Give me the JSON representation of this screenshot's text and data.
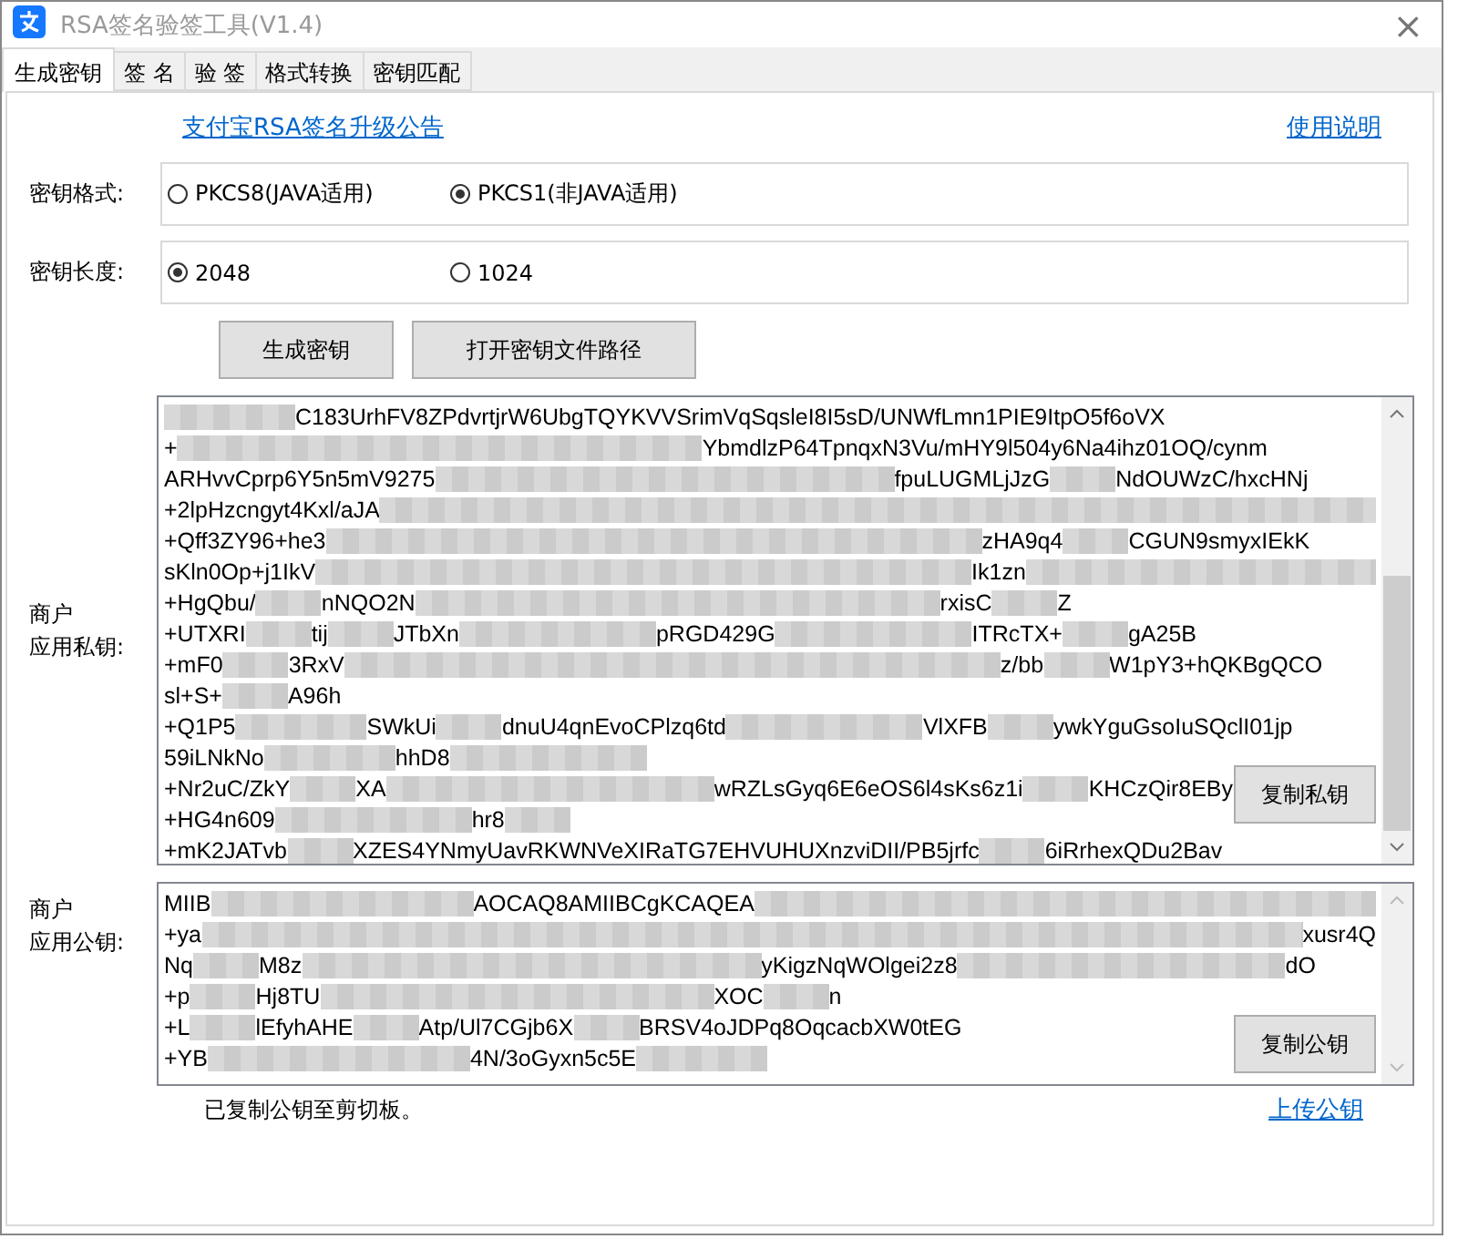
{
  "window": {
    "title": "RSA签名验签工具(V1.4)",
    "close": "×"
  },
  "tabs": [
    {
      "label": "生成密钥",
      "selected": true
    },
    {
      "label": "签 名",
      "selected": false
    },
    {
      "label": "验 签",
      "selected": false
    },
    {
      "label": "格式转换",
      "selected": false
    },
    {
      "label": "密钥匹配",
      "selected": false
    }
  ],
  "links": {
    "notice": "支付宝RSA签名升级公告",
    "help": "使用说明"
  },
  "key_format": {
    "label": "密钥格式:",
    "options": [
      {
        "label": "PKCS8(JAVA适用)",
        "selected": false
      },
      {
        "label": "PKCS1(非JAVA适用)",
        "selected": true
      }
    ]
  },
  "key_length": {
    "label": "密钥长度:",
    "options": [
      {
        "label": "2048",
        "selected": true
      },
      {
        "label": "1024",
        "selected": false
      }
    ]
  },
  "buttons": [
    "生成密钥",
    "打开密钥文件路径"
  ],
  "private_key": {
    "label": [
      "商户",
      "应用私钥:"
    ],
    "button": "复制私钥",
    "lines": [
      [
        {
          "kind": "blur"
        },
        {
          "kind": "blur"
        },
        "C183UrhFV8ZPdvrtjrW6UbgTQYKVVSrimVqSqsleI8I5sD/UNWfLmn1PIE9ItpO5f6oVX"
      ],
      [
        "+",
        {
          "kind": "blur"
        },
        {
          "kind": "blur"
        },
        {
          "kind": "blur"
        },
        {
          "kind": "blur"
        },
        {
          "kind": "blur"
        },
        {
          "kind": "blur"
        },
        {
          "kind": "blur"
        },
        {
          "kind": "blur"
        },
        "YbmdlzP64TpnqxN3Vu/mHY9l504y6Na4ihz01OQ/cynm"
      ],
      [
        "ARHvvCprp6Y5n5mV9275",
        {
          "kind": "blur"
        },
        {
          "kind": "blur"
        },
        {
          "kind": "blur"
        },
        {
          "kind": "blur"
        },
        {
          "kind": "blur"
        },
        {
          "kind": "blur"
        },
        {
          "kind": "blur"
        },
        "fpuLUGMLjJzG",
        {
          "kind": "blur"
        },
        "NdOUWzC/hxcHNj"
      ],
      [
        "+2lpHzcngyt4Kxl/aJA",
        {
          "kind": "blur_fill"
        }
      ],
      [
        "+Qff3ZY96+he3",
        {
          "kind": "blur"
        },
        {
          "kind": "blur"
        },
        {
          "kind": "blur"
        },
        {
          "kind": "blur"
        },
        {
          "kind": "blur"
        },
        {
          "kind": "blur"
        },
        {
          "kind": "blur"
        },
        {
          "kind": "blur"
        },
        {
          "kind": "blur"
        },
        {
          "kind": "blur"
        },
        "zHA9q4",
        {
          "kind": "blur"
        },
        "CGUN9smyxIEkK"
      ],
      [
        "sKln0Op+j1IkV",
        {
          "kind": "blur"
        },
        {
          "kind": "blur"
        },
        {
          "kind": "blur"
        },
        {
          "kind": "blur"
        },
        {
          "kind": "blur"
        },
        {
          "kind": "blur"
        },
        {
          "kind": "blur"
        },
        {
          "kind": "blur"
        },
        {
          "kind": "blur"
        },
        {
          "kind": "blur"
        },
        "Ik1zn",
        {
          "kind": "blur_fill"
        }
      ],
      [
        "+HgQbu/",
        {
          "kind": "blur"
        },
        "nNQO2N",
        {
          "kind": "blur"
        },
        {
          "kind": "blur"
        },
        {
          "kind": "blur"
        },
        {
          "kind": "blur"
        },
        {
          "kind": "blur"
        },
        {
          "kind": "blur"
        },
        {
          "kind": "blur"
        },
        {
          "kind": "blur"
        },
        "rxisC",
        {
          "kind": "blur"
        },
        "Z"
      ],
      [
        "+UTXRI",
        {
          "kind": "blur"
        },
        "tij",
        {
          "kind": "blur"
        },
        "JTbXn",
        {
          "kind": "blur"
        },
        {
          "kind": "blur"
        },
        {
          "kind": "blur"
        },
        "pRGD429G",
        {
          "kind": "blur"
        },
        {
          "kind": "blur"
        },
        {
          "kind": "blur"
        },
        "ITRcTX+",
        {
          "kind": "blur"
        },
        "gA25B"
      ],
      [
        "+mF0",
        {
          "kind": "blur"
        },
        "3RxV",
        {
          "kind": "blur"
        },
        {
          "kind": "blur"
        },
        {
          "kind": "blur"
        },
        {
          "kind": "blur"
        },
        {
          "kind": "blur"
        },
        {
          "kind": "blur"
        },
        {
          "kind": "blur"
        },
        {
          "kind": "blur"
        },
        {
          "kind": "blur"
        },
        {
          "kind": "blur"
        },
        "z/bb",
        {
          "kind": "blur"
        },
        "W1pY3+hQKBgQCO"
      ],
      [
        "sl+S+",
        {
          "kind": "blur"
        },
        "A96h"
      ],
      [
        "+Q1P5",
        {
          "kind": "blur"
        },
        {
          "kind": "blur"
        },
        "SWkUi",
        {
          "kind": "blur"
        },
        "dnuU4qnEvoCPlzq6td",
        {
          "kind": "blur"
        },
        {
          "kind": "blur"
        },
        {
          "kind": "blur"
        },
        "VlXFB",
        {
          "kind": "blur"
        },
        "ywkYguGsoIuSQclI01jp"
      ],
      [
        "59iLNkNo",
        {
          "kind": "blur"
        },
        {
          "kind": "blur"
        },
        "hhD8",
        {
          "kind": "blur"
        },
        {
          "kind": "blur"
        },
        {
          "kind": "blur"
        }
      ],
      [
        "+Nr2uC/ZkY",
        {
          "kind": "blur"
        },
        "XA",
        {
          "kind": "blur"
        },
        {
          "kind": "blur"
        },
        {
          "kind": "blur"
        },
        {
          "kind": "blur"
        },
        {
          "kind": "blur"
        },
        "wRZLsGyq6E6eOS6l4sKs6z1i",
        {
          "kind": "blur"
        },
        "KHCzQir8EBy"
      ],
      [
        "+HG4n609",
        {
          "kind": "blur"
        },
        {
          "kind": "blur"
        },
        {
          "kind": "blur"
        },
        "hr8",
        {
          "kind": "blur"
        }
      ],
      [
        "+mK2JATvb",
        {
          "kind": "blur"
        },
        "XZES4YNmyUavRKWNVeXIRaTG7EHVUHUXnzviDII/PB5jrfc",
        {
          "kind": "blur"
        },
        "6iRrhexQDu2Bav"
      ]
    ]
  },
  "public_key": {
    "label": [
      "商户",
      "应用公钥:"
    ],
    "button": "复制公钥",
    "lines": [
      [
        "MIIB",
        {
          "kind": "blur"
        },
        {
          "kind": "blur"
        },
        {
          "kind": "blur"
        },
        {
          "kind": "blur"
        },
        "AOCAQ8AMIIBCgKCAQEA",
        {
          "kind": "blur_fill"
        }
      ],
      [
        "+ya",
        {
          "kind": "blur_fill"
        },
        "xusr4Q"
      ],
      [
        "Nq",
        {
          "kind": "blur"
        },
        "M8z",
        {
          "kind": "blur"
        },
        {
          "kind": "blur"
        },
        {
          "kind": "blur"
        },
        {
          "kind": "blur"
        },
        {
          "kind": "blur"
        },
        {
          "kind": "blur"
        },
        {
          "kind": "blur"
        },
        "yKigzNqWOlgei2z8",
        {
          "kind": "blur"
        },
        {
          "kind": "blur"
        },
        {
          "kind": "blur"
        },
        {
          "kind": "blur"
        },
        {
          "kind": "blur"
        },
        "dO"
      ],
      [
        "+p",
        {
          "kind": "blur"
        },
        "Hj8TU",
        {
          "kind": "blur"
        },
        {
          "kind": "blur"
        },
        {
          "kind": "blur"
        },
        {
          "kind": "blur"
        },
        {
          "kind": "blur"
        },
        {
          "kind": "blur"
        },
        "XOC",
        {
          "kind": "blur"
        },
        "n"
      ],
      [
        "+L",
        {
          "kind": "blur"
        },
        "lEfyhAHE",
        {
          "kind": "blur"
        },
        "Atp/Ul7CGjb6X",
        {
          "kind": "blur"
        },
        "BRSV4oJDPq8OqcacbXW0tEG"
      ],
      [
        "+YB",
        {
          "kind": "blur"
        },
        {
          "kind": "blur"
        },
        {
          "kind": "blur"
        },
        {
          "kind": "blur"
        },
        "4N/3oGyxn5c5E",
        {
          "kind": "blur"
        },
        {
          "kind": "blur"
        }
      ]
    ]
  },
  "status": "已复制公钥至剪切板。",
  "upload_link": "上传公钥"
}
